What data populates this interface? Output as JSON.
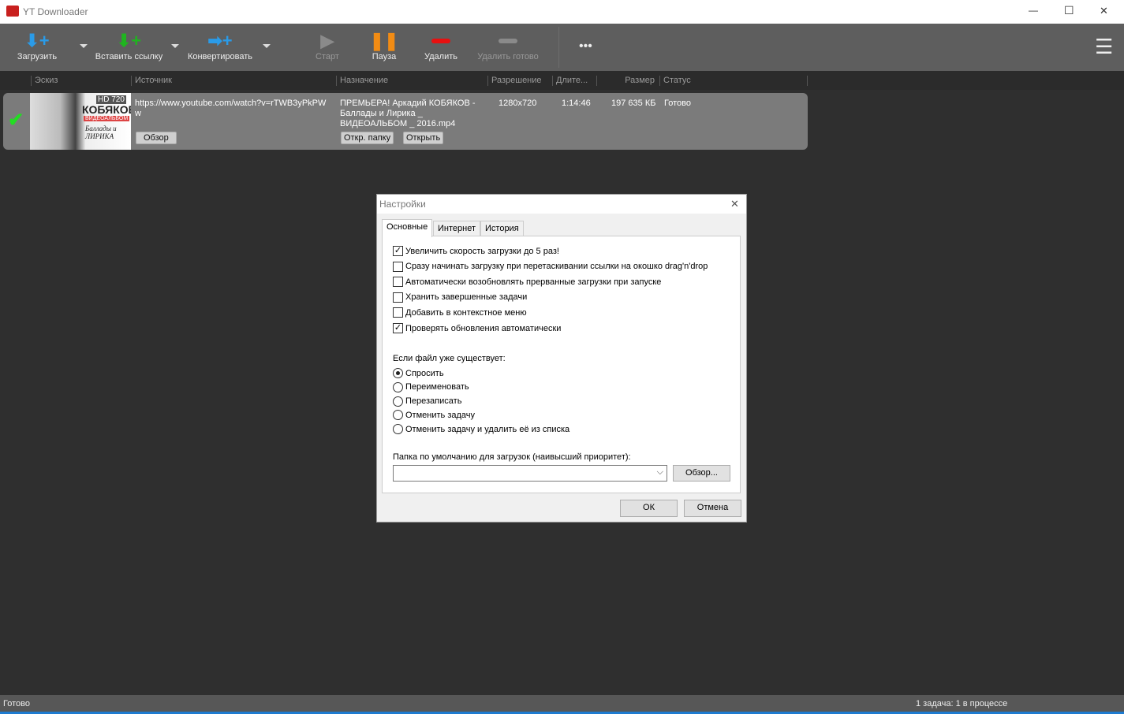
{
  "window": {
    "title": "YT Downloader",
    "min": "—",
    "max": "☐",
    "close": "✕"
  },
  "toolbar": {
    "download": "Загрузить",
    "paste": "Вставить ссылку",
    "convert": "Конвертировать",
    "start": "Старт",
    "pause": "Пауза",
    "delete": "Удалить",
    "delete_done": "Удалить готово",
    "more": "•••",
    "menu": "☰"
  },
  "columns": [
    "Эскиз",
    "Источник",
    "Назначение",
    "Разрешение",
    "Длите...",
    "Размер",
    "Статус"
  ],
  "task": {
    "thumb_badge": "HD 720",
    "thumb_title": "КОБЯКОВ",
    "thumb_sub": "ВИДЕОАЛЬБОМ",
    "thumb_script": "Баллады и ЛИРИКА",
    "source": "https://www.youtube.com/watch?v=rTWB3yPkPWw",
    "browse": "Обзор",
    "destination": "ПРЕМЬЕРА! Аркадий КОБЯКОВ - Баллады и Лирика _ ВИДЕОАЛЬБОМ _ 2016.mp4",
    "open_folder": "Откр. папку",
    "open": "Открыть",
    "resolution": "1280x720",
    "duration": "1:14:46",
    "size": "197 635 КБ",
    "status": "Готово"
  },
  "statusbar": {
    "left": "Готово",
    "right": "1 задача: 1 в процессе"
  },
  "dialog": {
    "title": "Настройки",
    "close": "✕",
    "tabs": [
      "Основные",
      "Интернет",
      "История"
    ],
    "checkboxes": [
      {
        "label": "Увеличить скорость загрузки до 5 раз!",
        "checked": true
      },
      {
        "label": "Сразу начинать загрузку при перетаскивании ссылки на окошко drag'n'drop",
        "checked": false
      },
      {
        "label": "Автоматически возобновлять прерванные загрузки при запуске",
        "checked": false
      },
      {
        "label": "Хранить завершенные задачи",
        "checked": false
      },
      {
        "label": "Добавить в контекстное меню",
        "checked": false
      },
      {
        "label": "Проверять обновления автоматически",
        "checked": true
      }
    ],
    "exists_label": "Если файл уже существует:",
    "radios": [
      {
        "label": "Спросить",
        "checked": true
      },
      {
        "label": "Переименовать",
        "checked": false
      },
      {
        "label": "Перезаписать",
        "checked": false
      },
      {
        "label": "Отменить задачу",
        "checked": false
      },
      {
        "label": "Отменить задачу и удалить её из списка",
        "checked": false
      }
    ],
    "folder_label": "Папка по умолчанию для загрузок (наивысший приоритет):",
    "folder_value": "",
    "browse": "Обзор...",
    "ok": "ОК",
    "cancel": "Отмена"
  }
}
